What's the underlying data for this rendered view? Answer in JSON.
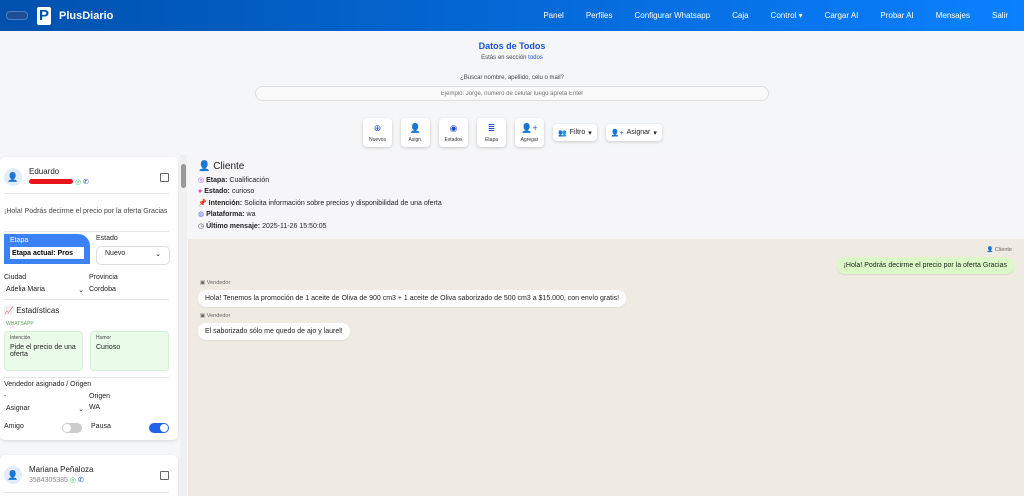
{
  "nav": {
    "brand": "PlusDiario",
    "items": [
      "Panel",
      "Perfiles",
      "Configurar Whatsapp",
      "Caja",
      "Control ▾",
      "Cargar AI",
      "Probar AI",
      "Mensajes",
      "Salir"
    ]
  },
  "header": {
    "title": "Datos de Todos",
    "subtitle_prefix": "Estás en sección",
    "subtitle_link": "todos",
    "search_label": "¿Buscar nombre, apellido, celu o mail?",
    "search_placeholder": "Ejemplo: Jorge, número de celular luego apretá Enter"
  },
  "toolbar": {
    "buttons": [
      "Nuevos",
      "Asign.",
      "Estados",
      "Etapa",
      "Agregar"
    ],
    "filtro": "Filtro",
    "asignar": "Asignar"
  },
  "contacts": [
    {
      "name": "Eduardo",
      "message": "¡Hola! Podrás decirme el precio por la oferta Gracias",
      "etapa_label": "Etapa",
      "etapa_value": "Etapa actual: Pros",
      "estado_label": "Estado",
      "estado_value": "Nuevo",
      "ciudad_label": "Ciudad",
      "ciudad_value": "Adelia Maria",
      "provincia_label": "Provincia",
      "provincia_value": "Cordoba",
      "stats_title": "Estadísticas",
      "source": "WHATSAPP",
      "intencion_label": "Intención",
      "intencion_value": "Pide el precio de una oferta",
      "humor_label": "Humor",
      "humor_value": "Curioso",
      "vendedor_label": "Vendedor asignado / Origen",
      "vendedor_dash": "-",
      "vendedor_value": "Asignar",
      "origen_label": "Origen",
      "origen_value": "WA",
      "amigo_label": "Amigo",
      "amigo_on": false,
      "pausa_label": "Pausa",
      "pausa_on": true
    },
    {
      "name": "Mariana Peñaloza",
      "phone": "3584305385"
    }
  ],
  "client": {
    "title": "Cliente",
    "etapa_k": "Etapa:",
    "etapa_v": "Cualificación",
    "estado_k": "Estado:",
    "estado_v": "curioso",
    "intencion_k": "Intención:",
    "intencion_v": "Solicita información sobre precios y disponibilidad de una oferta",
    "plataforma_k": "Plataforma:",
    "plataforma_v": "wa",
    "ultimo_k": "Último mensaje:",
    "ultimo_v": "2025-11-26 15:50:05"
  },
  "chat": [
    {
      "sender": "Cliente",
      "text": "¡Hola! Podrás decirme el precio por la oferta Gracias"
    },
    {
      "sender": "Vendedor",
      "text": "Hola! Tenemos la promoción de 1 aceite de Oliva de 900 cm3 + 1 aceite de Oliva saborizado de 500 cm3 a $15.000, con envío gratis!"
    },
    {
      "sender": "Vendedor",
      "text": "El saborizado sólo me quedo de ajo y laurel!"
    }
  ],
  "colors": {
    "primary": "#1f4fd1",
    "nav_start": "#0051ad",
    "nav_end": "#0a80ff",
    "chat_bg": "#efeae2",
    "client_bubble": "#dcf8c6"
  }
}
